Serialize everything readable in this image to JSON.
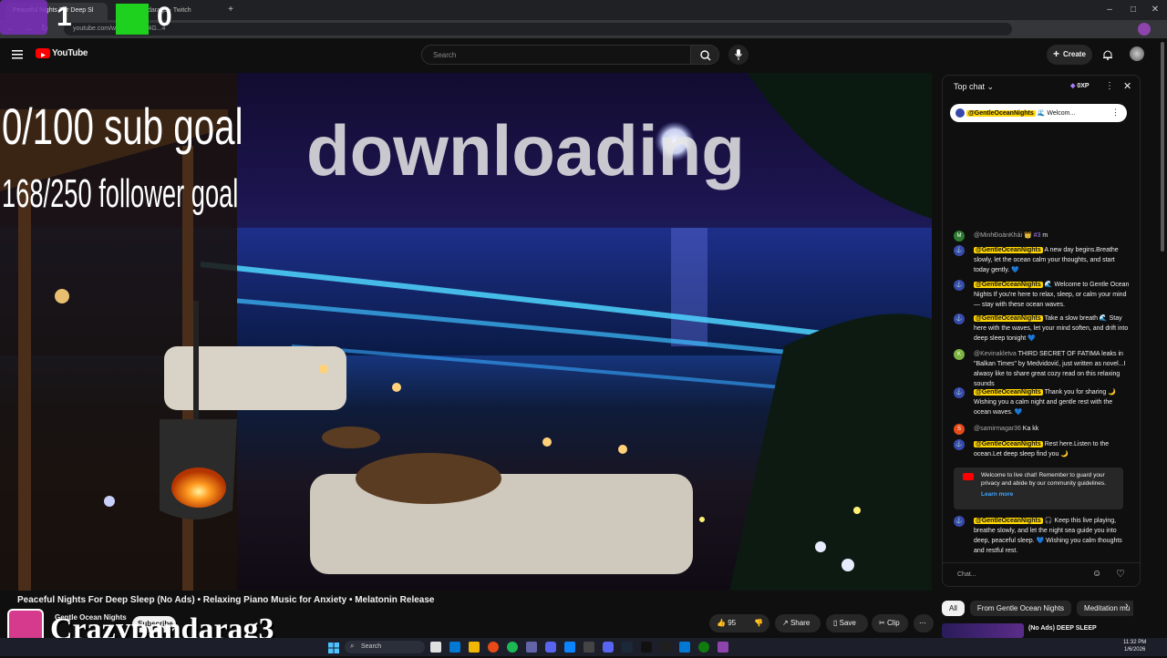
{
  "browser": {
    "tabs": [
      {
        "label": "Peaceful Nights For Deep Sl"
      },
      {
        "label": "Crazypandarag3 - Twitch"
      }
    ],
    "url": "youtube.com/watch?v=...Y4G...4"
  },
  "youtube": {
    "logo": "YouTube",
    "search_placeholder": "Search",
    "create_label": "Create"
  },
  "stream_overlay": {
    "counter_left": "1",
    "counter_right": "0",
    "sub_goal": "0/100 sub goal",
    "follower_goal": "168/250 follower goal",
    "big_text": "downloading",
    "streamer_name": "Crazypandarag3"
  },
  "video": {
    "title": "Peaceful Nights For Deep Sleep (No Ads) • Relaxing Piano Music for Anxiety • Melatonin Release",
    "channel": "Gentle Ocean Nights",
    "subscribe_label": "Subscribe",
    "likes": "95",
    "share_label": "Share",
    "save_label": "Save",
    "clip_label": "Clip"
  },
  "chat": {
    "header": "Top chat",
    "xp": "0XP",
    "pinned_author": "@GentleOceanNights",
    "pinned_text": "🌊 Welcom...",
    "messages": [
      {
        "avatar": "M",
        "author": "@MinhĐoànKhải",
        "badge": "👑 #3",
        "text": "m",
        "color": "#2e7d32"
      },
      {
        "avatar": "⚓",
        "author": "@GentleOceanNights",
        "owner": true,
        "text": "A new day begins.Breathe slowly, let the ocean calm your thoughts, and start today gently. 💙",
        "color": "#3949ab"
      },
      {
        "avatar": "⚓",
        "author": "@GentleOceanNights",
        "owner": true,
        "text": "🌊 Welcome to Gentle Ocean Nights If you're here to relax, sleep, or calm your mind — stay with these ocean waves.",
        "color": "#3949ab"
      },
      {
        "avatar": "⚓",
        "author": "@GentleOceanNights",
        "owner": true,
        "text": "Take a slow breath 🌊 Stay here with the waves, let your mind soften, and drift into deep sleep tonight 💙",
        "color": "#3949ab"
      },
      {
        "avatar": "K",
        "author": "@Kevinakletva",
        "text": "THIRD SECRET OF FATIMA leaks in \"Balkan Times\" by Medvidović, just written as novel...I alwasy like to share great cozy read on this relaxing sounds",
        "color": "#7cb342"
      },
      {
        "avatar": "⚓",
        "author": "@GentleOceanNights",
        "owner": true,
        "text": "Thank you for sharing 🌙 Wishing you a calm night and gentle rest with the ocean waves. 💙",
        "color": "#3949ab"
      },
      {
        "avatar": "S",
        "author": "@samirmagar36",
        "text": "Ka kk",
        "color": "#e64a19"
      },
      {
        "avatar": "⚓",
        "author": "@GentleOceanNights",
        "owner": true,
        "text": "Rest here.Listen to the ocean.Let deep sleep find you 🌙",
        "color": "#3949ab"
      },
      {
        "avatar": "⚓",
        "author": "@GentleOceanNights",
        "owner": true,
        "text": "🎧 Keep this live playing, breathe slowly, and let the night sea guide you into deep, peaceful sleep. 💙 Wishing you calm thoughts and restful rest.",
        "color": "#3949ab"
      }
    ],
    "notice": "Welcome to live chat! Remember to guard your privacy and abide by our community guidelines.",
    "learn_more": "Learn more",
    "input_placeholder": "Chat..."
  },
  "bottom_tabs": [
    "All",
    "From Gentle Ocean Nights",
    "Meditation mu"
  ],
  "recommended_title": "(No Ads) DEEP SLEEP",
  "taskbar": {
    "search": "Search",
    "time": "11:32 PM",
    "date": "1/6/2026"
  }
}
